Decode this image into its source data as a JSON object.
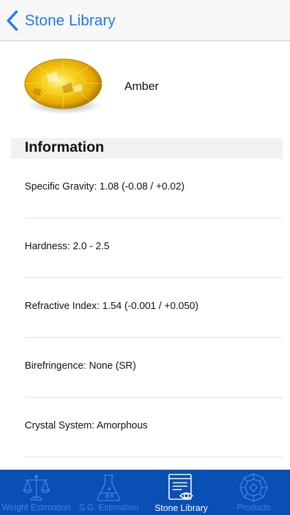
{
  "navbar": {
    "back_label": "Stone Library"
  },
  "stone": {
    "name": "Amber",
    "photo_icon": "yellow-gemstone-photo"
  },
  "section": {
    "title": "Information"
  },
  "info_rows": [
    {
      "text": "Specific Gravity: 1.08 (-0.08 / +0.02)"
    },
    {
      "text": "Hardness: 2.0 - 2.5"
    },
    {
      "text": "Refractive Index: 1.54 (-0.001 / +0.050)"
    },
    {
      "text": "Birefringence: None (SR)"
    },
    {
      "text": "Crystal System: Amorphous"
    }
  ],
  "tabbar": {
    "tabs": [
      {
        "label": "Weight Estimation",
        "icon": "scale-icon",
        "active": false
      },
      {
        "label": "S.G. Estimation",
        "icon": "flask-icon",
        "active": false
      },
      {
        "label": "Stone Library",
        "icon": "library-eye-icon",
        "active": true
      },
      {
        "label": "Products",
        "icon": "diamond-icon",
        "active": false
      }
    ]
  },
  "colors": {
    "accent": "#1e7cf2",
    "tabbar_bg": "#0a4fb4",
    "tab_inactive": "#3b7fe0",
    "tab_active": "#ffffff"
  }
}
